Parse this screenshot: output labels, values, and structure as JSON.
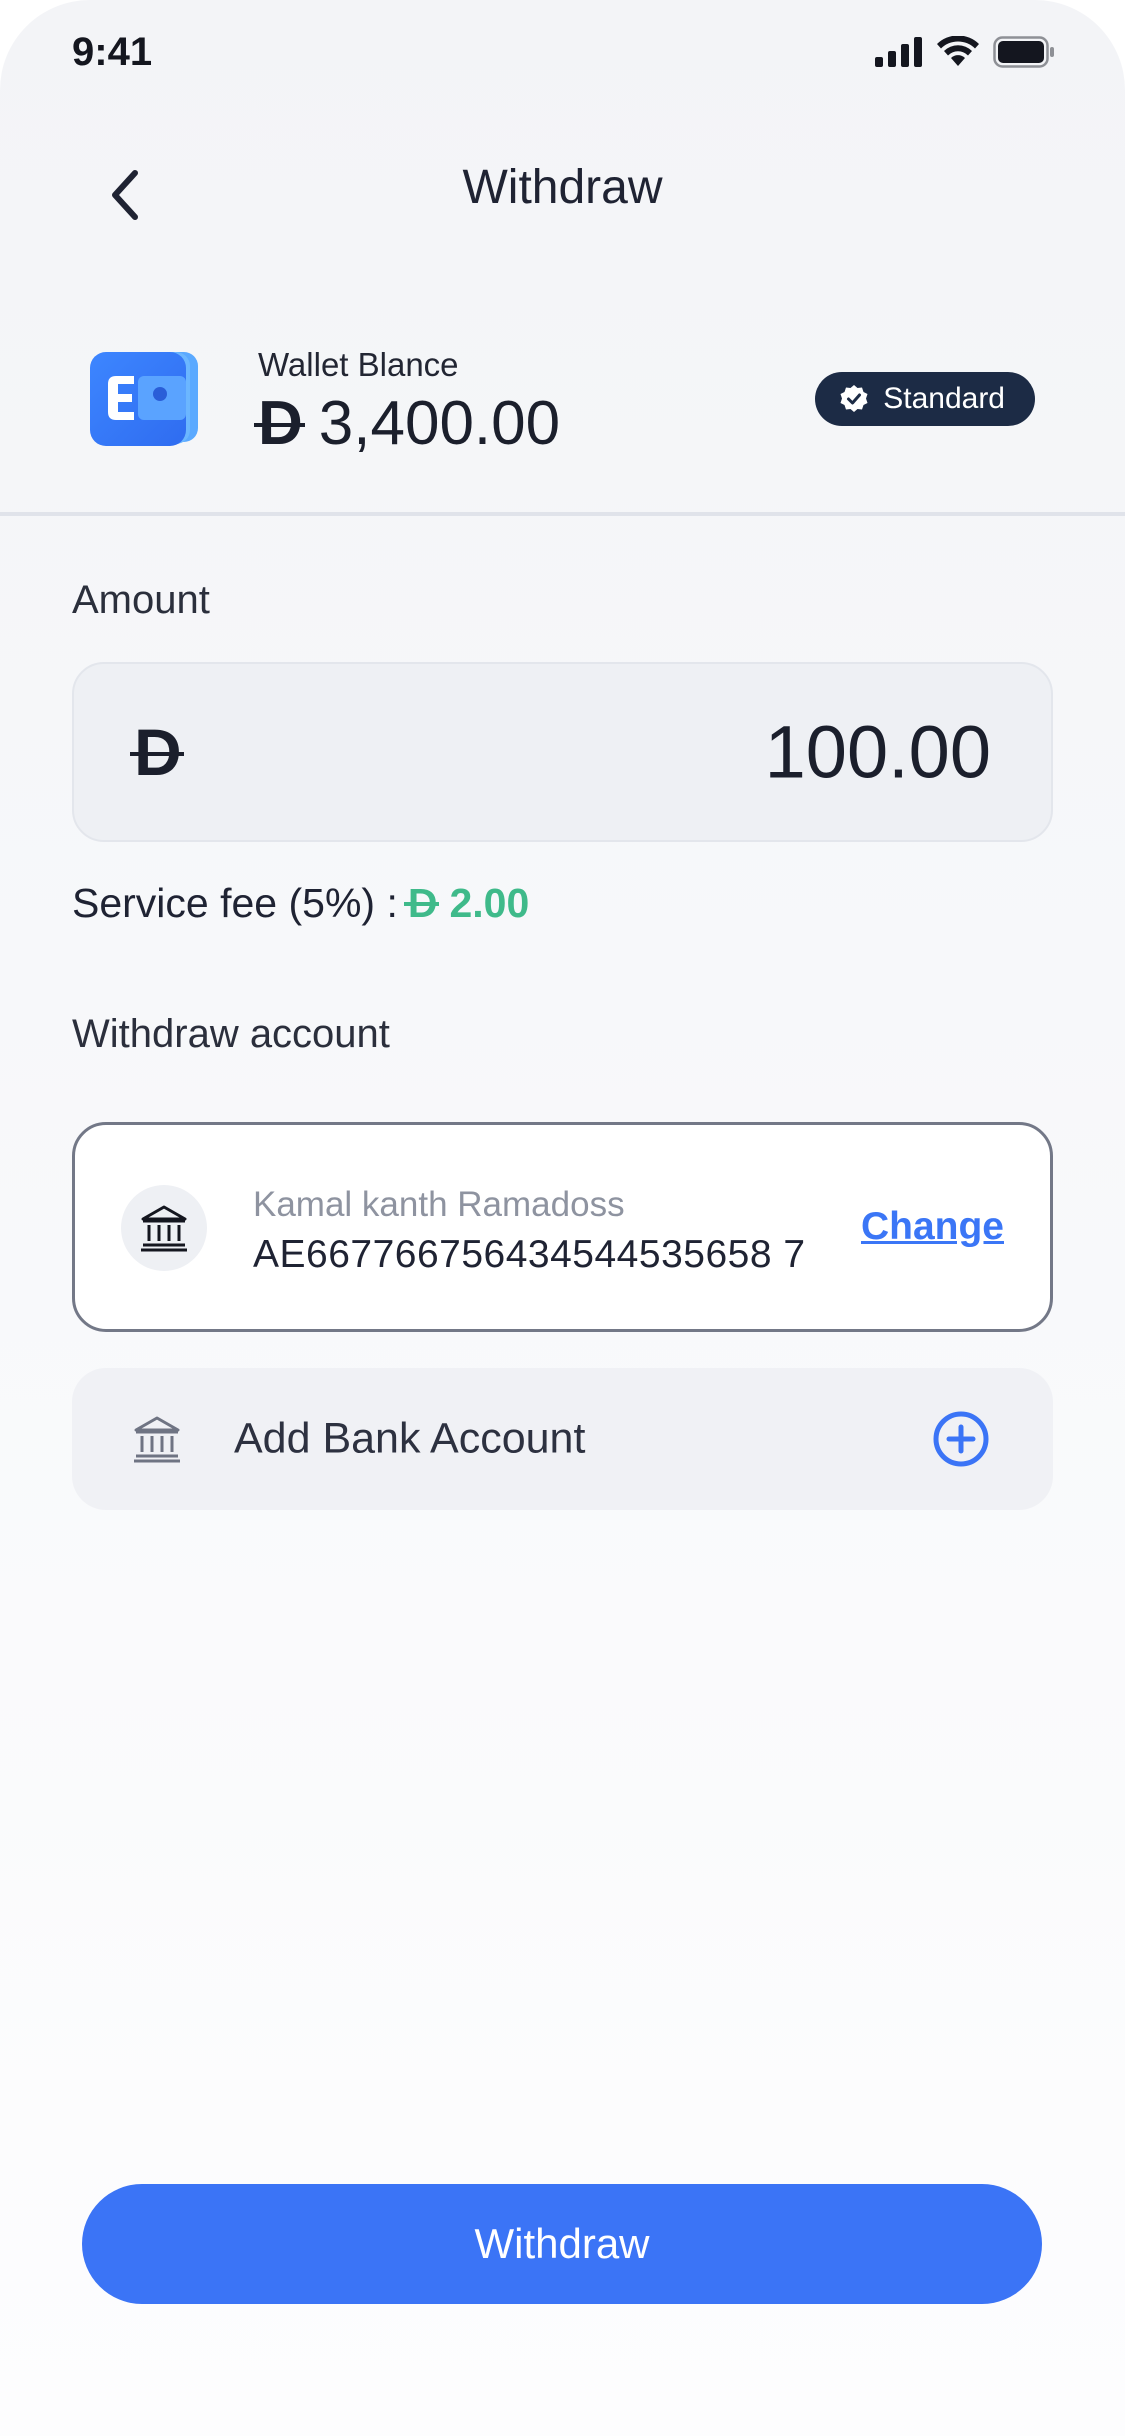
{
  "status_bar": {
    "time": "9:41"
  },
  "header": {
    "title": "Withdraw"
  },
  "wallet": {
    "label": "Wallet Blance",
    "currency_symbol": "D",
    "balance": "3,400.00",
    "badge": "Standard"
  },
  "amount": {
    "label": "Amount",
    "currency_symbol": "D",
    "value": "100.00"
  },
  "fee": {
    "label": "Service fee (5%) :",
    "currency_symbol": "D",
    "value": "2.00"
  },
  "withdraw_account": {
    "label": "Withdraw account",
    "holder_name": "Kamal kanth Ramadoss",
    "account_number": "AE667766756434544535658 7",
    "change_label": "Change"
  },
  "add_bank": {
    "label": "Add Bank Account"
  },
  "cta": {
    "label": "Withdraw"
  },
  "colors": {
    "primary": "#3b74f6",
    "fee_green": "#3fba8a",
    "badge_bg": "#1c2b45"
  }
}
